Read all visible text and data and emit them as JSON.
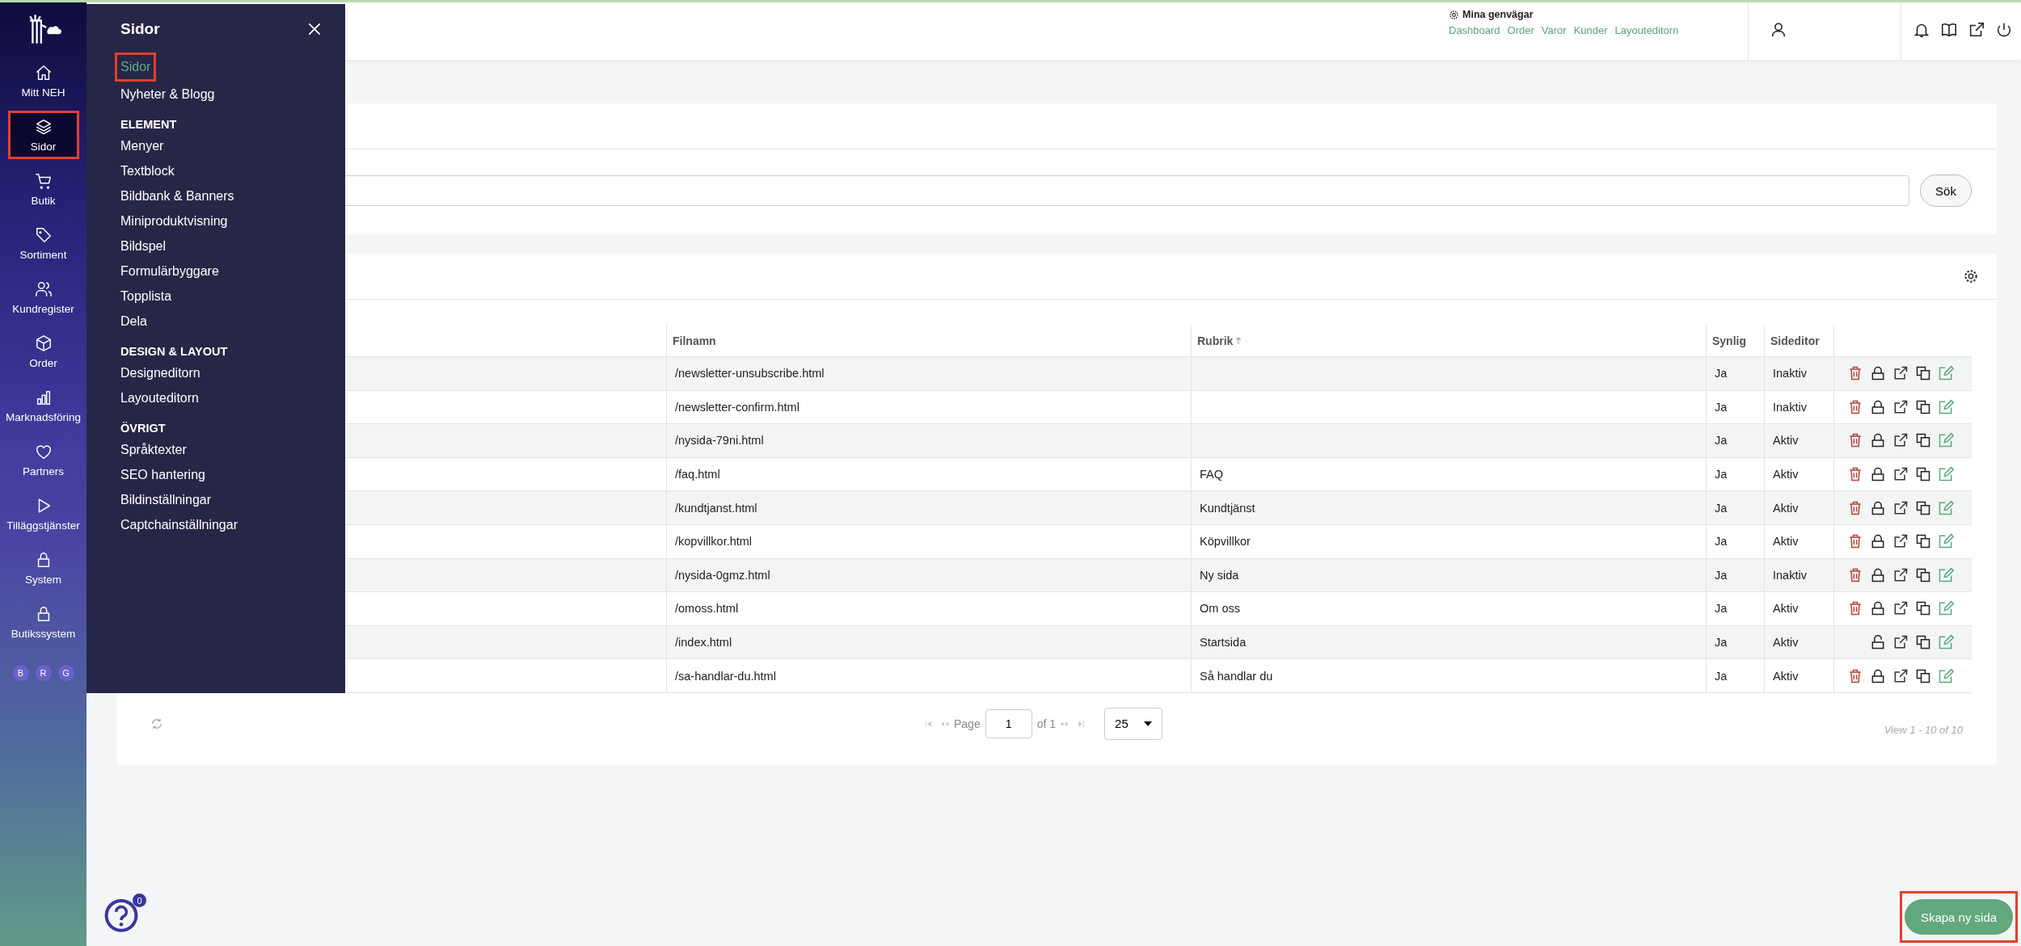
{
  "sidebar": {
    "items": [
      {
        "label": "Mitt NEH",
        "selected": false
      },
      {
        "label": "Sidor",
        "selected": true
      },
      {
        "label": "Butik",
        "selected": false
      },
      {
        "label": "Sortiment",
        "selected": false
      },
      {
        "label": "Kundregister",
        "selected": false
      },
      {
        "label": "Order",
        "selected": false
      },
      {
        "label": "Marknadsföring",
        "selected": false
      },
      {
        "label": "Partners",
        "selected": false
      },
      {
        "label": "Tilläggstjänster",
        "selected": false
      },
      {
        "label": "System",
        "selected": false
      },
      {
        "label": "Butikssystem",
        "selected": false
      }
    ],
    "avatars": [
      "B",
      "R",
      "G"
    ]
  },
  "flyout": {
    "title": "Sidor",
    "sections": [
      {
        "items": [
          {
            "label": "Sidor",
            "selected": true
          },
          {
            "label": "Nyheter & Blogg",
            "selected": false
          }
        ]
      },
      {
        "heading": "ELEMENT",
        "items": [
          {
            "label": "Menyer",
            "selected": false
          },
          {
            "label": "Textblock",
            "selected": false
          },
          {
            "label": "Bildbank & Banners",
            "selected": false
          },
          {
            "label": "Miniproduktvisning",
            "selected": false
          },
          {
            "label": "Bildspel",
            "selected": false
          },
          {
            "label": "Formulärbyggare",
            "selected": false
          },
          {
            "label": "Topplista",
            "selected": false
          },
          {
            "label": "Dela",
            "selected": false
          }
        ]
      },
      {
        "heading": "DESIGN & LAYOUT",
        "items": [
          {
            "label": "Designeditorn",
            "selected": false
          },
          {
            "label": "Layouteditorn",
            "selected": false
          }
        ]
      },
      {
        "heading": "ÖVRIGT",
        "items": [
          {
            "label": "Språktexter",
            "selected": false
          },
          {
            "label": "SEO hantering",
            "selected": false
          },
          {
            "label": "Bildinställningar",
            "selected": false
          },
          {
            "label": "Captchainställningar",
            "selected": false
          }
        ]
      }
    ]
  },
  "header": {
    "shortcuts": {
      "title": "Mina genvägar",
      "links": [
        "Dashboard",
        "Order",
        "Varor",
        "Kunder",
        "Layouteditorn"
      ]
    }
  },
  "search_card": {
    "button": "Sök"
  },
  "table_card": {
    "columns": [
      {
        "label": "Filnamn",
        "sorted": false
      },
      {
        "label": "Rubrik",
        "sorted": true
      },
      {
        "label": "Synlig",
        "sorted": false
      },
      {
        "label": "Sideditor",
        "sorted": false
      }
    ],
    "rows": [
      {
        "file": "/newsletter-unsubscribe.html",
        "visible": "Ja",
        "editor": "Inaktiv",
        "deletable": true,
        "locked": true
      },
      {
        "file": "/newsletter-confirm.html",
        "visible": "Ja",
        "editor": "Inaktiv",
        "deletable": true,
        "locked": true
      },
      {
        "file": "/nysida-79ni.html",
        "visible": "Ja",
        "editor": "Aktiv",
        "deletable": true,
        "locked": true
      },
      {
        "file": "/faq.html",
        "title": "FAQ",
        "visible": "Ja",
        "editor": "Aktiv",
        "deletable": true,
        "locked": true
      },
      {
        "file": "/kundtjanst.html",
        "title": "Kundtjänst",
        "visible": "Ja",
        "editor": "Aktiv",
        "deletable": true,
        "locked": true
      },
      {
        "file": "/kopvillkor.html",
        "title": "Köpvillkor",
        "visible": "Ja",
        "editor": "Aktiv",
        "deletable": true,
        "locked": true
      },
      {
        "file": "/nysida-0gmz.html",
        "title": "Ny sida",
        "visible": "Ja",
        "editor": "Inaktiv",
        "deletable": true,
        "locked": true
      },
      {
        "file": "/omoss.html",
        "title": "Om oss",
        "visible": "Ja",
        "editor": "Aktiv",
        "deletable": true,
        "locked": true
      },
      {
        "file": "/index.html",
        "title": "Startsida",
        "visible": "Ja",
        "editor": "Aktiv",
        "deletable": false,
        "locked": false
      },
      {
        "file": "/sa-handlar-du.html",
        "title": "Så handlar du",
        "visible": "Ja",
        "editor": "Aktiv",
        "deletable": true,
        "locked": true
      }
    ]
  },
  "pagination": {
    "page_label": "Page",
    "page": "1",
    "of": "of 1",
    "page_size": "25",
    "summary": "View 1 - 10 of 10"
  },
  "help": {
    "badge": "0"
  },
  "create_button": "Skapa ny sida"
}
